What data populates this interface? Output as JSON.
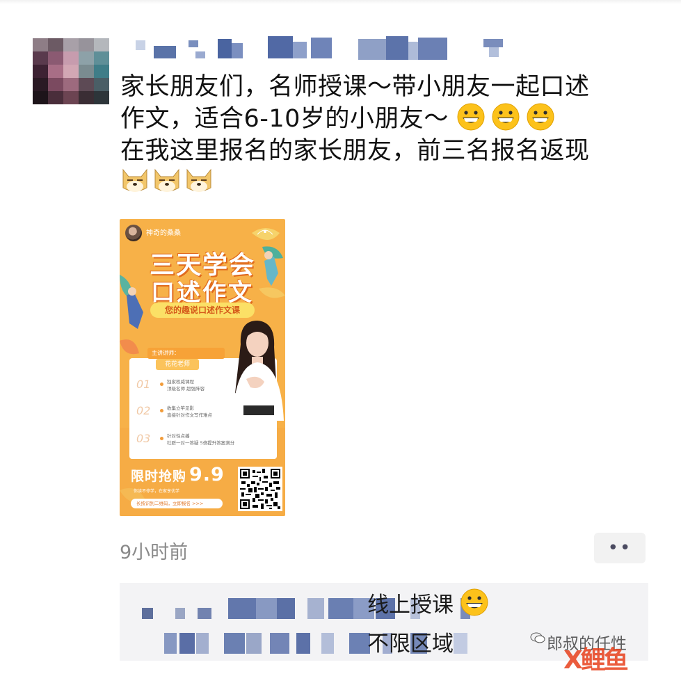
{
  "post": {
    "line1": "家长朋友们，名师授课～带小朋友一起口述",
    "line2": "作文，适合6-10岁的小朋友～",
    "line3": "在我这里报名的家长朋友，前三名报名返现",
    "emoji_smile": "grinning-face-icon",
    "emoji_doge": "doge-icon"
  },
  "poster": {
    "username": "神奇的桑桑",
    "title1": "三天学会",
    "title2": "口述作文",
    "subtitle": "您的趣说口述作文课",
    "teacher_tag": "主讲讲师：",
    "teacher_name": "花花老师",
    "steps": [
      {
        "num": "01",
        "l1": "独家权威课程",
        "l2": "顶级名师 超强阵容"
      },
      {
        "num": "02",
        "l1": "收集立竿见影",
        "l2": "直接针对作文写作难点"
      },
      {
        "num": "03",
        "l1": "针对性点播",
        "l2": "社群一对一答疑  5倍提升答案满分"
      }
    ],
    "price_label": "限时抢购",
    "price": "9.9",
    "price_note": "你读不停学，在家享优学",
    "scan_text": "长按识别二维码，立即报名  >>>"
  },
  "meta": {
    "time": "9小时前",
    "more": "••"
  },
  "comments": {
    "line1": "线上授课",
    "line2": "不限区域"
  },
  "watermark": {
    "text": "郎叔的任性",
    "logo": "X鲤鱼"
  },
  "colors": {
    "poster_bg": "#f7b148",
    "accent": "#e06a1d"
  }
}
